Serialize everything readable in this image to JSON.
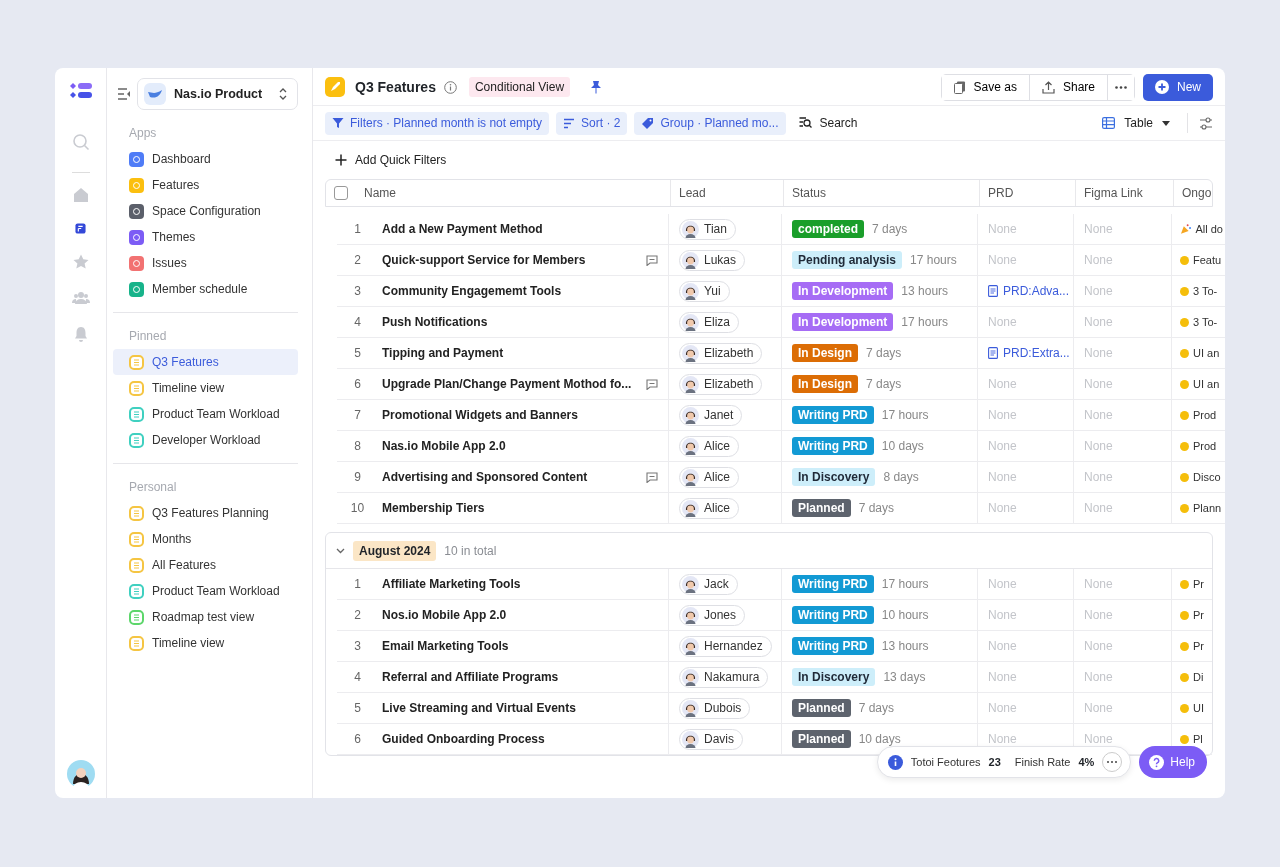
{
  "rail": [
    {
      "kind": "search",
      "selected": false
    },
    {
      "kind": "home",
      "selected": false
    },
    {
      "kind": "app",
      "selected": true
    },
    {
      "kind": "star",
      "selected": false
    },
    {
      "kind": "people",
      "selected": false
    },
    {
      "kind": "bell",
      "selected": false
    }
  ],
  "workspace": {
    "name": "Nas.io Product"
  },
  "sections": [
    {
      "title": "Apps",
      "kind": "apps",
      "items": [
        {
          "label": "Dashboard",
          "color": "#4f7cf7",
          "selected": false
        },
        {
          "label": "Features",
          "color": "#fbbf0f",
          "selected": false
        },
        {
          "label": "Space Configuration",
          "color": "#5b5f6a",
          "selected": false
        },
        {
          "label": "Themes",
          "color": "#7c5cf5",
          "selected": false
        },
        {
          "label": "Issues",
          "color": "#f27272",
          "selected": false
        },
        {
          "label": "Member schedule",
          "color": "#17b38a",
          "selected": false
        }
      ]
    },
    {
      "title": "Pinned",
      "kind": "views",
      "items": [
        {
          "label": "Q3 Features",
          "color": "#f5c542",
          "selected": true
        },
        {
          "label": "Timeline view",
          "color": "#f5c542",
          "selected": false
        },
        {
          "label": "Product Team Workload",
          "color": "#3fd0c0",
          "selected": false
        },
        {
          "label": "Developer Workload",
          "color": "#3fd0c0",
          "selected": false
        }
      ]
    },
    {
      "title": "Personal",
      "kind": "views",
      "items": [
        {
          "label": "Q3 Features Planning",
          "color": "#f5c542",
          "selected": false
        },
        {
          "label": "Months",
          "color": "#f5c542",
          "selected": false
        },
        {
          "label": "All Features",
          "color": "#f5c542",
          "selected": false
        },
        {
          "label": "Product Team Workload",
          "color": "#3fd0c0",
          "selected": false
        },
        {
          "label": "Roadmap test view",
          "color": "#5cd66a",
          "selected": false
        },
        {
          "label": "Timeline view",
          "color": "#f5c542",
          "selected": false
        }
      ]
    }
  ],
  "header": {
    "title": "Q3 Features",
    "badge": "Conditional View",
    "pinned": true,
    "buttons": [
      "Save as",
      "Share"
    ],
    "primary": "New"
  },
  "toolbar": {
    "chips": [
      {
        "kind": "filter",
        "label": "Filters · Planned month is not empty"
      },
      {
        "kind": "sort",
        "label": "Sort · 2"
      },
      {
        "kind": "group",
        "label": "Group · Planned mo..."
      }
    ],
    "search": "Search",
    "view": "Table"
  },
  "quick_filters": "Add Quick Filters",
  "select_all": {
    "checked": false
  },
  "columns": [
    "Name",
    "Lead",
    "Status",
    "PRD",
    "Figma Link",
    "Ongo"
  ],
  "groups": [
    {
      "rows": [
        {
          "no": "1",
          "name": "Add a New Payment Method",
          "comment": false,
          "lead": "Tian",
          "status": {
            "label": "completed",
            "color": "#1a9e2a"
          },
          "time": "7 days",
          "prd": "None",
          "prd_link": false,
          "figma": "None",
          "ongoing": {
            "kind": "party",
            "text": "All do"
          }
        },
        {
          "no": "2",
          "name": "Quick-support Service for Members",
          "comment": true,
          "lead": "Lukas",
          "status": {
            "label": "Pending analysis",
            "color": "#cdeefa"
          },
          "time": "17 hours",
          "prd": "None",
          "prd_link": false,
          "figma": "None",
          "ongoing": {
            "kind": "dot",
            "text": "Featu"
          }
        },
        {
          "no": "3",
          "name": "Community Engagememt Tools",
          "comment": false,
          "lead": "Yui",
          "status": {
            "label": "In Development",
            "color": "#a66cf5"
          },
          "time": "13 hours",
          "prd": "PRD:Adva...",
          "prd_link": true,
          "figma": "None",
          "ongoing": {
            "kind": "dot",
            "text": "3 To-"
          }
        },
        {
          "no": "4",
          "name": "Push Notifications",
          "comment": false,
          "lead": "Eliza",
          "status": {
            "label": "In Development",
            "color": "#a66cf5"
          },
          "time": "17 hours",
          "prd": "None",
          "prd_link": false,
          "figma": "None",
          "ongoing": {
            "kind": "dot",
            "text": "3 To-"
          }
        },
        {
          "no": "5",
          "name": "Tipping and Payment",
          "comment": false,
          "lead": "Elizabeth",
          "status": {
            "label": "In Design",
            "color": "#dc6d05"
          },
          "time": "7 days",
          "prd": "PRD:Extra...",
          "prd_link": true,
          "figma": "None",
          "ongoing": {
            "kind": "dot",
            "text": "UI an"
          }
        },
        {
          "no": "6",
          "name": "Upgrade Plan/Change Payment Mothod fo...",
          "comment": true,
          "lead": "Elizabeth",
          "status": {
            "label": "In Design",
            "color": "#dc6d05"
          },
          "time": "7 days",
          "prd": "None",
          "prd_link": false,
          "figma": "None",
          "ongoing": {
            "kind": "dot",
            "text": "UI an"
          }
        },
        {
          "no": "7",
          "name": "Promotional Widgets and Banners",
          "comment": false,
          "lead": "Janet",
          "status": {
            "label": "Writing PRD",
            "color": "#129ad4"
          },
          "time": "17 hours",
          "prd": "None",
          "prd_link": false,
          "figma": "None",
          "ongoing": {
            "kind": "dot",
            "text": "Prod"
          }
        },
        {
          "no": "8",
          "name": "Nas.io Mobile App 2.0",
          "comment": false,
          "lead": "Alice",
          "status": {
            "label": "Writing PRD",
            "color": "#129ad4"
          },
          "time": "10 days",
          "prd": "None",
          "prd_link": false,
          "figma": "None",
          "ongoing": {
            "kind": "dot",
            "text": "Prod"
          }
        },
        {
          "no": "9",
          "name": "Advertising and Sponsored Content",
          "comment": true,
          "lead": "Alice",
          "status": {
            "label": "In Discovery",
            "color": "#cdeefa"
          },
          "time": "8 days",
          "prd": "None",
          "prd_link": false,
          "figma": "None",
          "ongoing": {
            "kind": "dot",
            "text": "Disco"
          }
        },
        {
          "no": "10",
          "name": "Membership Tiers",
          "comment": false,
          "lead": "Alice",
          "status": {
            "label": "Planned",
            "color": "#5d636d"
          },
          "time": "7 days",
          "prd": "None",
          "prd_link": false,
          "figma": "None",
          "ongoing": {
            "kind": "dot",
            "text": "Plann"
          }
        }
      ]
    },
    {
      "label": "August 2024",
      "count": "10 in total",
      "expanded": true,
      "rows": [
        {
          "no": "1",
          "name": "Affiliate Marketing Tools",
          "comment": false,
          "lead": "Jack",
          "status": {
            "label": "Writing PRD",
            "color": "#129ad4"
          },
          "time": "17 hours",
          "prd": "None",
          "prd_link": false,
          "figma": "None",
          "ongoing": {
            "kind": "dot",
            "text": "Pr"
          }
        },
        {
          "no": "2",
          "name": "Nos.io Mobile App 2.0",
          "comment": false,
          "lead": "Jones",
          "status": {
            "label": "Writing PRD",
            "color": "#129ad4"
          },
          "time": "10 hours",
          "prd": "None",
          "prd_link": false,
          "figma": "None",
          "ongoing": {
            "kind": "dot",
            "text": "Pr"
          }
        },
        {
          "no": "3",
          "name": "Email Marketing Tools",
          "comment": false,
          "lead": "Hernandez",
          "status": {
            "label": "Writing PRD",
            "color": "#129ad4"
          },
          "time": "13 hours",
          "prd": "None",
          "prd_link": false,
          "figma": "None",
          "ongoing": {
            "kind": "dot",
            "text": "Pr"
          }
        },
        {
          "no": "4",
          "name": "Referral and Affiliate Programs",
          "comment": false,
          "lead": "Nakamura",
          "status": {
            "label": "In Discovery",
            "color": "#cdeefa"
          },
          "time": "13 days",
          "prd": "None",
          "prd_link": false,
          "figma": "None",
          "ongoing": {
            "kind": "dot",
            "text": "Di"
          }
        },
        {
          "no": "5",
          "name": "Live Streaming and Virtual Events",
          "comment": false,
          "lead": "Dubois",
          "status": {
            "label": "Planned",
            "color": "#5d636d"
          },
          "time": "7 days",
          "prd": "None",
          "prd_link": false,
          "figma": "None",
          "ongoing": {
            "kind": "dot",
            "text": "UI"
          }
        },
        {
          "no": "6",
          "name": "Guided Onboarding Process",
          "comment": false,
          "lead": "Davis",
          "status": {
            "label": "Planned",
            "color": "#5d636d"
          },
          "time": "10 days",
          "prd": "None",
          "prd_link": false,
          "figma": "None",
          "ongoing": {
            "kind": "dot",
            "text": "Pl"
          }
        }
      ]
    }
  ],
  "footer": {
    "total_label": "Totoi Feotures",
    "total": "23",
    "rate_label": "Finish Rate",
    "rate": "4%"
  },
  "help": "Help"
}
